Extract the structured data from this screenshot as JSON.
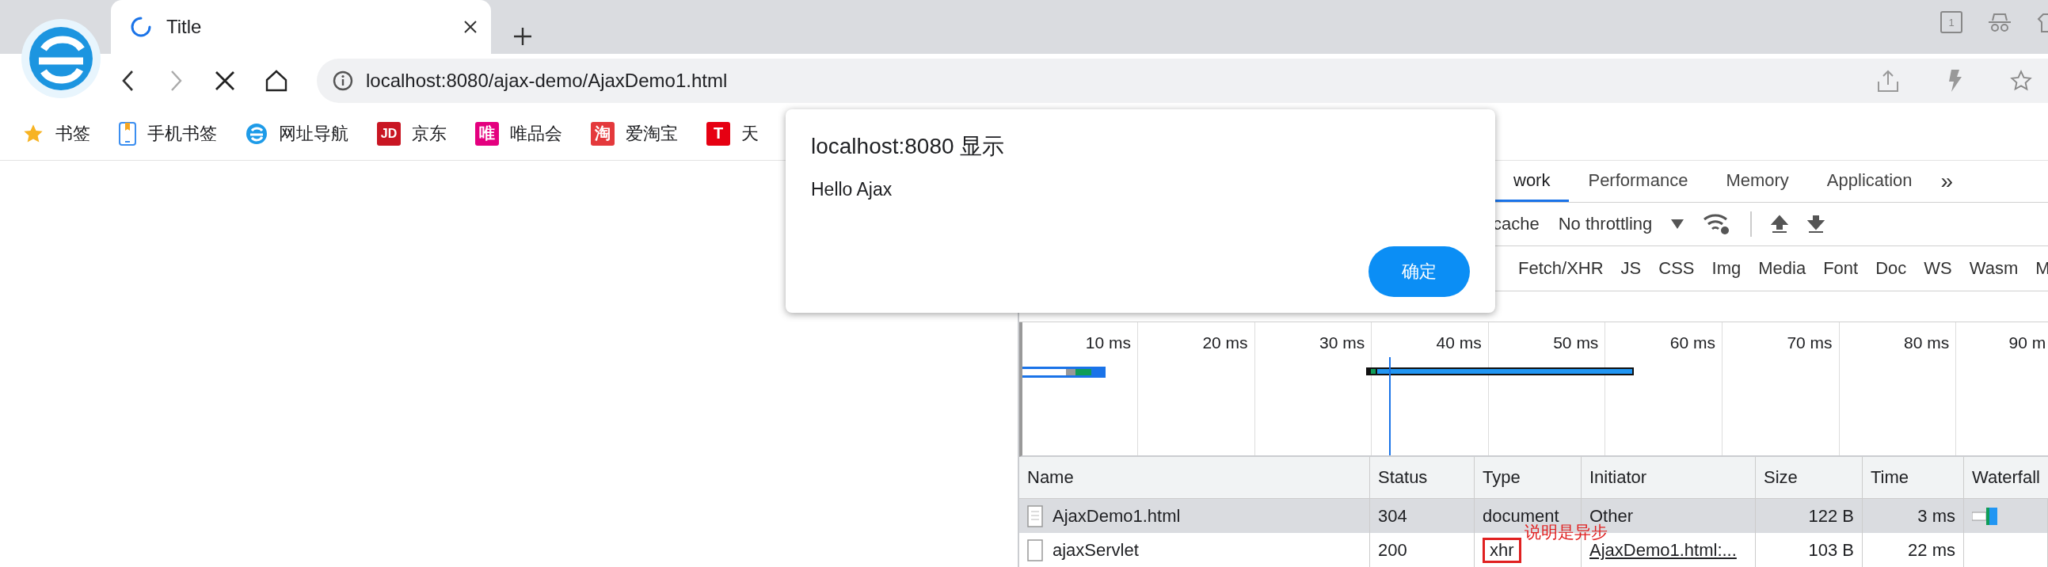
{
  "browser": {
    "tab": {
      "title": "Title",
      "loading": true
    },
    "address": "localhost:8080/ajax-demo/AjaxDemo1.html",
    "tab_count": "1",
    "bookmarks": [
      {
        "kind": "star",
        "label": "书签"
      },
      {
        "kind": "phone",
        "label": "手机书签"
      },
      {
        "kind": "logo",
        "label": "网址导航"
      },
      {
        "kind": "badge",
        "badge": "JD",
        "color": "#c91623",
        "label": "京东"
      },
      {
        "kind": "badge",
        "badge": "唯",
        "color": "#e4007f",
        "label": "唯品会"
      },
      {
        "kind": "badge",
        "badge": "淘",
        "color": "#e4393c",
        "label": "爱淘宝"
      },
      {
        "kind": "badge",
        "badge": "T",
        "color": "#e60012",
        "label": "天"
      }
    ]
  },
  "dialog": {
    "title": "localhost:8080 显示",
    "message": "Hello Ajax",
    "button": "确定"
  },
  "devtools": {
    "tabs": [
      {
        "label": "work",
        "selected": true
      },
      {
        "label": "Performance",
        "selected": false
      },
      {
        "label": "Memory",
        "selected": false
      },
      {
        "label": "Application",
        "selected": false
      }
    ],
    "more": "»",
    "cache_label": "cache",
    "throttling": "No throttling",
    "filters": [
      "Fetch/XHR",
      "JS",
      "CSS",
      "Img",
      "Media",
      "Font",
      "Doc",
      "WS",
      "Wasm",
      "M"
    ],
    "ticks": [
      "10 ms",
      "20 ms",
      "30 ms",
      "40 ms",
      "50 ms",
      "60 ms",
      "70 ms",
      "80 ms",
      "90 m"
    ],
    "table": {
      "columns": [
        "Name",
        "Status",
        "Type",
        "Initiator",
        "Size",
        "Time",
        "Waterfall"
      ],
      "rows": [
        {
          "name": "AjaxDemo1.html",
          "status": "304",
          "type": "document",
          "initiator": "Other",
          "initiator_link": false,
          "size": "122 B",
          "time": "3 ms",
          "selected": true
        },
        {
          "name": "ajaxServlet",
          "status": "200",
          "type": "xhr",
          "initiator": "AjaxDemo1.html:...",
          "initiator_link": true,
          "size": "103 B",
          "time": "22 ms",
          "selected": false,
          "note": "说明是异步"
        }
      ]
    }
  }
}
